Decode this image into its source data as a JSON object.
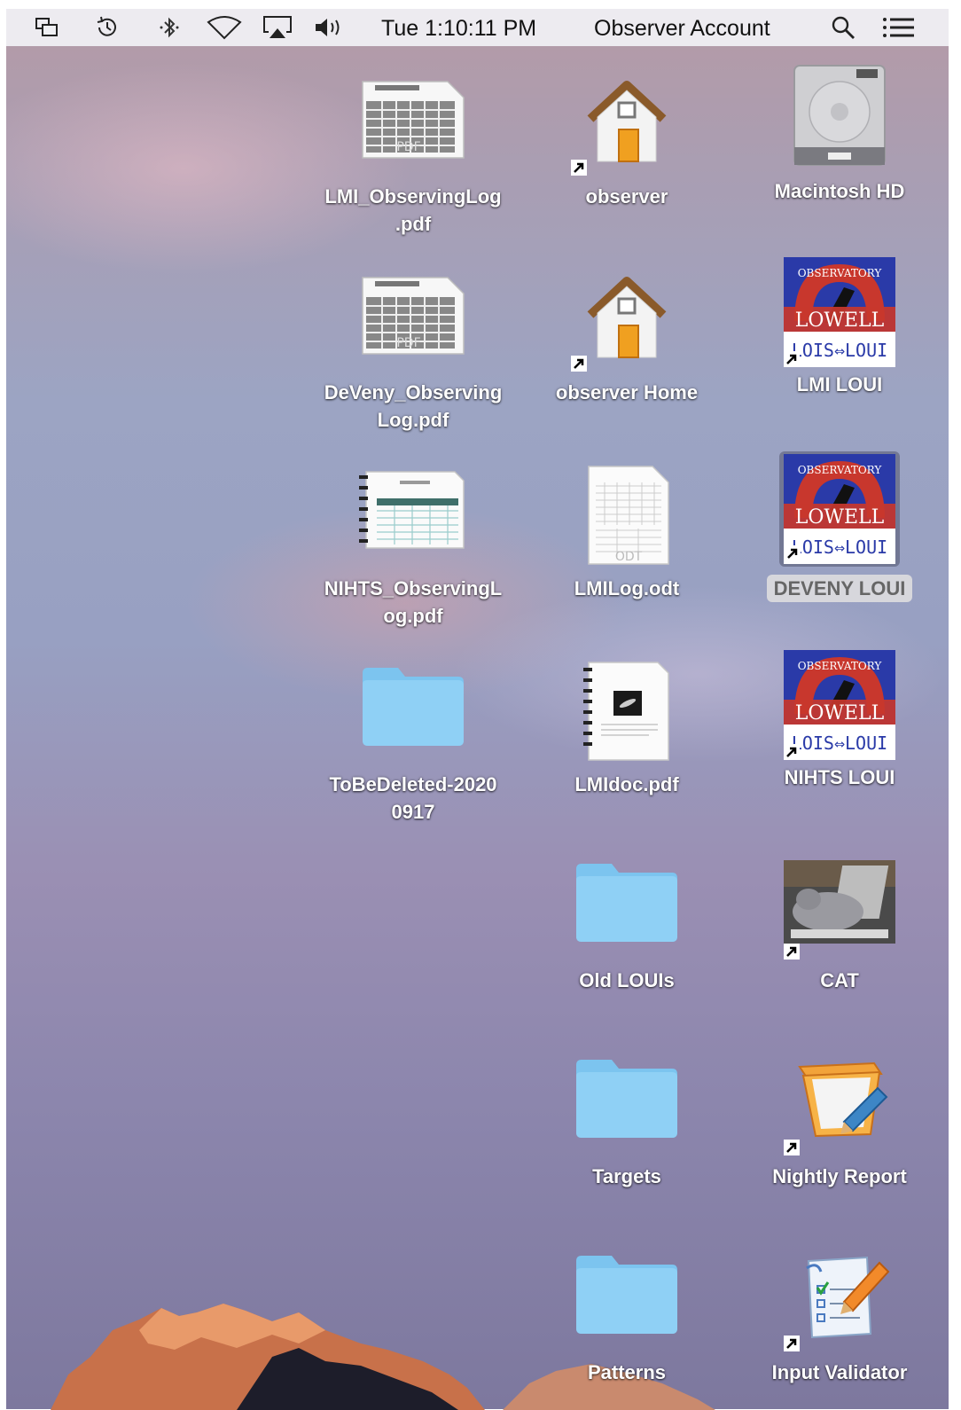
{
  "menubar": {
    "clock": "Tue 1:10:11 PM",
    "user": "Observer Account",
    "icons": [
      "display-mirror-icon",
      "time-machine-icon",
      "bluetooth-icon",
      "wifi-icon",
      "airplay-icon",
      "volume-icon",
      "spotlight-search-icon",
      "notification-center-icon"
    ]
  },
  "desktop": {
    "items": [
      {
        "label": "LMI_ObservingLog\n.pdf",
        "icon": "pdf-document-icon"
      },
      {
        "label": "observer",
        "icon": "home-folder-icon"
      },
      {
        "label": "Macintosh HD",
        "icon": "hard-drive-icon"
      },
      {
        "label": "DeVeny_Observing\nLog.pdf",
        "icon": "pdf-document-icon"
      },
      {
        "label": "observer Home",
        "icon": "home-folder-icon"
      },
      {
        "label": "LMI LOUI",
        "icon": "lowell-app-icon"
      },
      {
        "label": "NIHTS_ObservingL\nog.pdf",
        "icon": "pdf-document-icon"
      },
      {
        "label": "LMILog.odt",
        "icon": "odt-document-icon"
      },
      {
        "label": "DEVENY LOUI",
        "icon": "lowell-app-icon",
        "selected": true
      },
      {
        "label": "ToBeDeleted-2020\n0917",
        "icon": "folder-icon"
      },
      {
        "label": "LMIdoc.pdf",
        "icon": "pdf-document-icon"
      },
      {
        "label": "NIHTS LOUI",
        "icon": "lowell-app-icon"
      },
      {
        "label": "Old LOUIs",
        "icon": "folder-icon"
      },
      {
        "label": "CAT",
        "icon": "cat-photo-icon"
      },
      {
        "label": "Targets",
        "icon": "folder-icon"
      },
      {
        "label": "Nightly Report",
        "icon": "nightly-report-icon"
      },
      {
        "label": "Patterns",
        "icon": "folder-icon"
      },
      {
        "label": "Input Validator",
        "icon": "input-validator-icon"
      }
    ],
    "lowell_logo": {
      "arc_text": "OBSERVATORY",
      "name": "LOWELL",
      "bottom": "LOIS⇔LOUI"
    },
    "odt_tag": "ODT",
    "pdf_tag": "PDF"
  },
  "colors": {
    "folder": "#8fd0f5",
    "selection": "#d7d7dc",
    "lowell_red": "#c8372d",
    "lowell_blue": "#2a3aa8"
  }
}
